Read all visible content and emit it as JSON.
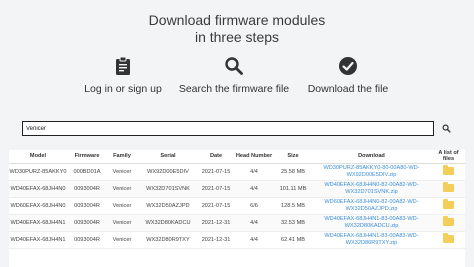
{
  "header": {
    "title_line1": "Download firmware modules",
    "title_line2": "in three steps"
  },
  "steps": [
    {
      "icon": "clipboard-icon",
      "label": "Log in or sign up"
    },
    {
      "icon": "search-icon",
      "label": "Search the firmware file"
    },
    {
      "icon": "check-circle-icon",
      "label": "Download the file"
    }
  ],
  "search": {
    "value": "Venicer",
    "placeholder": ""
  },
  "table": {
    "columns": [
      "Model",
      "Firmware",
      "Family",
      "Serial",
      "Date",
      "Head Number",
      "Size",
      "Download",
      "A list of files"
    ],
    "rows": [
      {
        "model": "WD30PURZ-85AKKY0",
        "firmware": "000BD01A",
        "family": "Venicer",
        "serial": "WX92D00E5DIV",
        "date": "2021-07-15",
        "heads": "4/4",
        "size": "25.58 MB",
        "dl1": "WD30PURZ-85AKKY0-80-00A80-WD-",
        "dl2": "WX92D00E5DIV.zip"
      },
      {
        "model": "WD40EFAX-68JH4N0",
        "firmware": "0093004R",
        "family": "Venicer",
        "serial": "WX32D701SVNK",
        "date": "2021-07-15",
        "heads": "4/4",
        "size": "101.11 MB",
        "dl1": "WD40EFAX-68JH4N0-82-00A82-WD-",
        "dl2": "WX32D701SVNK.zip"
      },
      {
        "model": "WD60EFAX-68JH4N0",
        "firmware": "0093004R",
        "family": "Venicer",
        "serial": "WX32D50AZJPD",
        "date": "2021-07-15",
        "heads": "6/6",
        "size": "128.5 MB",
        "dl1": "WD60EFAX-68JH4N0-82-00A82-WD-",
        "dl2": "WX32D50AZJPD.zip"
      },
      {
        "model": "WD40EFAX-68JH4N1",
        "firmware": "0093004R",
        "family": "Venicer",
        "serial": "WX32D80KADCU",
        "date": "2021-12-31",
        "heads": "4/4",
        "size": "32.53 MB",
        "dl1": "WD40EFAX-68JH4N1-83-00A83-WD-",
        "dl2": "WX32D80KADCU.zip"
      },
      {
        "model": "WD40EFAX-68JH4N1",
        "firmware": "0093004R",
        "family": "Venicer",
        "serial": "WX32D80R9TXY",
        "date": "2021-12-31",
        "heads": "4/4",
        "size": "62.41 MB",
        "dl1": "WD40EFAX-68JH4N1-83-00A83-WD-",
        "dl2": "WX32D80R9TXY.zip"
      }
    ]
  },
  "colors": {
    "link": "#3d8fd8",
    "folder": "#f3cf5a",
    "background": "#f3f4f6"
  }
}
